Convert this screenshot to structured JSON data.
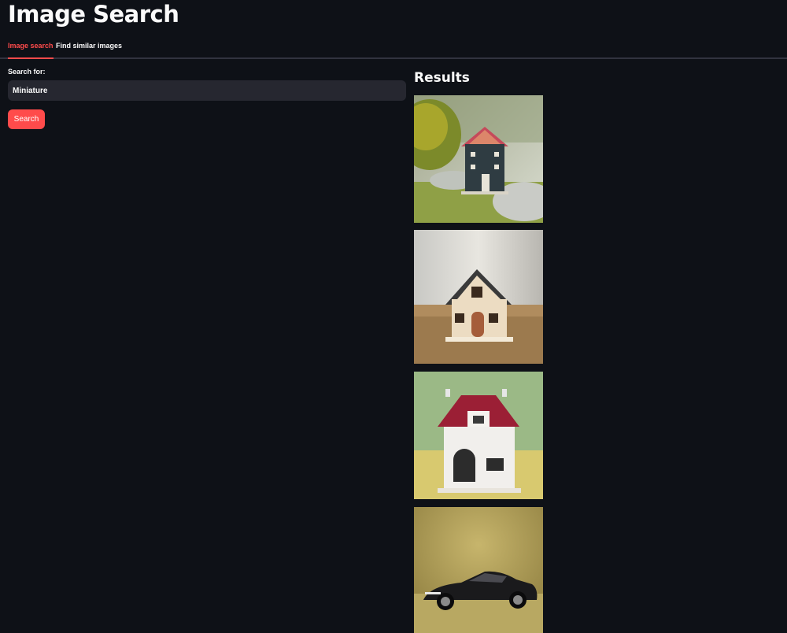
{
  "page": {
    "title": "Image Search"
  },
  "tabs": [
    {
      "label": "Image search",
      "active": true
    },
    {
      "label": "Find similar images",
      "active": false
    }
  ],
  "search": {
    "label": "Search for:",
    "value": "Miniature",
    "button_label": "Search"
  },
  "results": {
    "title": "Results",
    "items": [
      {
        "subject": "miniature blue house on grass"
      },
      {
        "subject": "miniature wooden house on table"
      },
      {
        "subject": "miniature white house with red roof"
      },
      {
        "subject": "miniature black sports car"
      }
    ]
  },
  "colors": {
    "background": "#0e1117",
    "accent": "#ff4b4b",
    "input_bg": "#262730",
    "text": "#fafafa"
  }
}
